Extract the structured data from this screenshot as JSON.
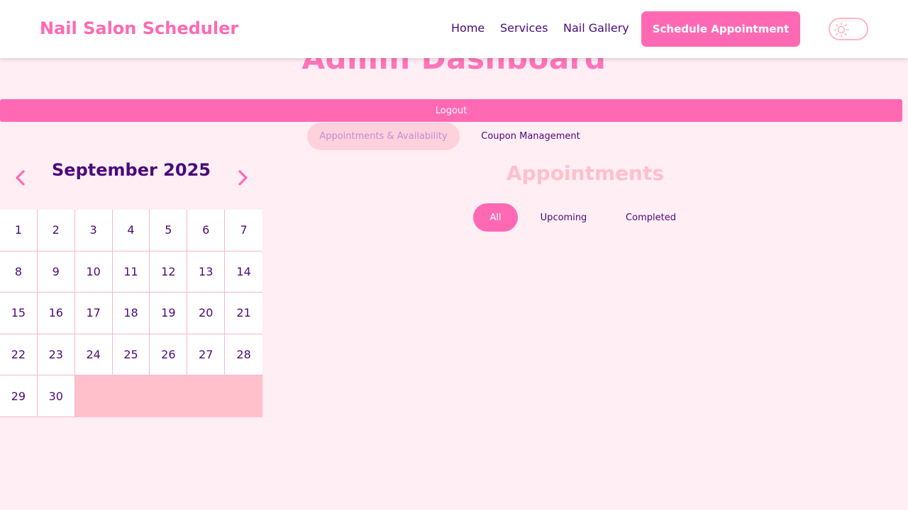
{
  "header": {
    "brand": "Nail Salon Scheduler",
    "nav": [
      "Home",
      "Services",
      "Nail Gallery"
    ],
    "schedule_label": "Schedule Appointment",
    "theme_icon": "sun-icon"
  },
  "page": {
    "title": "Admin Dashboard",
    "logout_label": "Logout",
    "tabs": [
      "Appointments & Availability",
      "Coupon Management"
    ],
    "active_tab": "Appointments & Availability"
  },
  "calendar": {
    "month_label": "September 2025",
    "prev_icon": "chevron-left-icon",
    "next_icon": "chevron-right-icon",
    "days": [
      "1",
      "2",
      "3",
      "4",
      "5",
      "6",
      "7",
      "8",
      "9",
      "10",
      "11",
      "12",
      "13",
      "14",
      "15",
      "16",
      "17",
      "18",
      "19",
      "20",
      "21",
      "22",
      "23",
      "24",
      "25",
      "26",
      "27",
      "28",
      "29",
      "30"
    ]
  },
  "appointments": {
    "title": "Appointments",
    "filters": [
      "All",
      "Upcoming",
      "Completed"
    ],
    "active_filter": "All"
  },
  "colors": {
    "accent": "#ff69b4",
    "background": "#ffeef4",
    "text": "#4a0a7a",
    "light_pink": "#ffc0cb"
  }
}
